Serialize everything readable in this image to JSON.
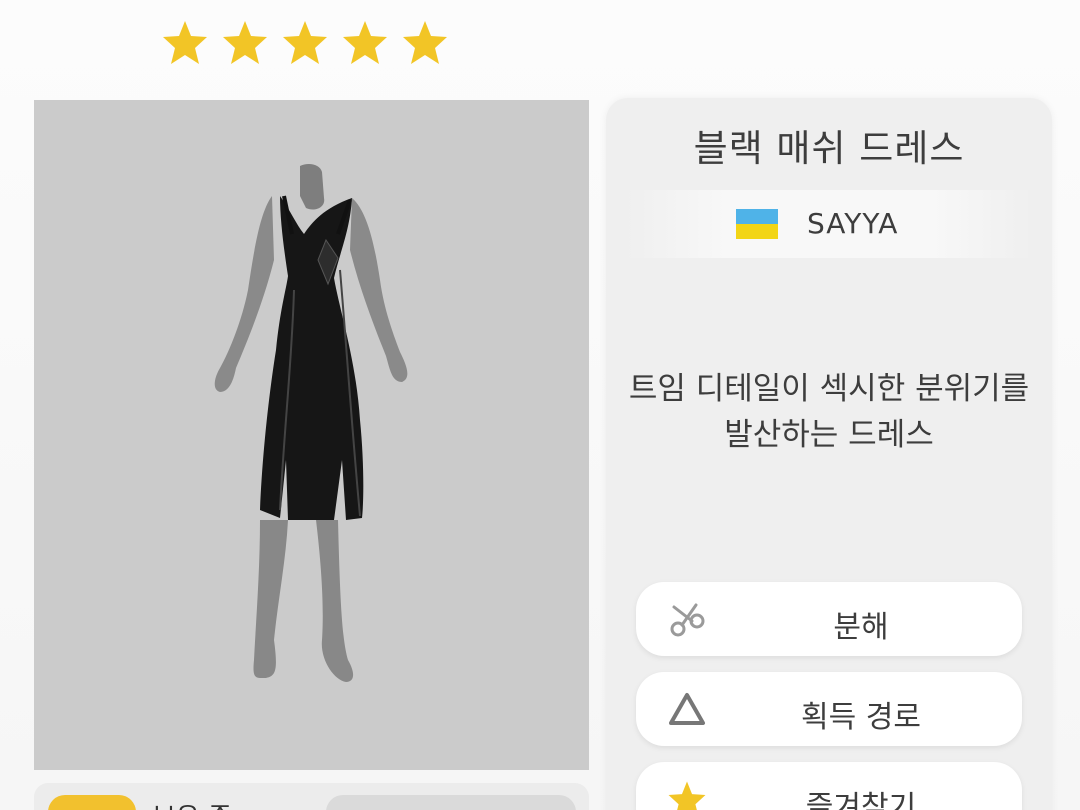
{
  "rating": {
    "stars": 5,
    "max": 5,
    "color": "#f2c526"
  },
  "item": {
    "name": "블랙 매쉬 드레스",
    "brand": {
      "name": "SAYYA",
      "flag_colors": [
        "#4fb3e8",
        "#f2d516"
      ]
    },
    "description_line1": "트임 디테일이 섹시한 분위기를",
    "description_line2": "발산하는 드레스"
  },
  "actions": {
    "dismantle_label": "분해",
    "source_label": "획득 경로",
    "favorite_label": "즐겨찾기"
  },
  "bottom": {
    "owned_label": "보유 중"
  },
  "icons": {
    "dismantle": "scissors-icon",
    "source": "triangle-icon",
    "favorite": "star-icon"
  }
}
